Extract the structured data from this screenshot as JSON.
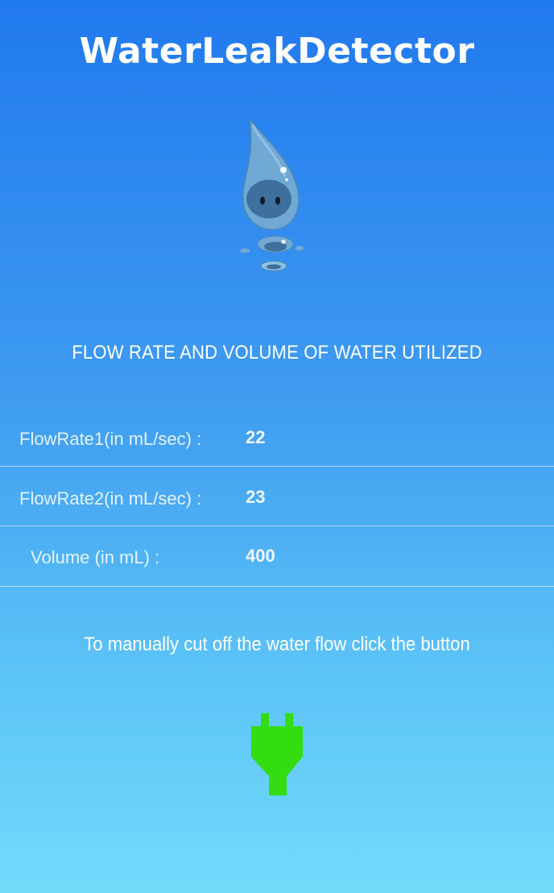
{
  "app": {
    "title": "WaterLeakDetector"
  },
  "section": {
    "heading": "FLOW RATE AND VOLUME OF WATER UTILIZED"
  },
  "readings": [
    {
      "label": "FlowRate1(in mL/sec) :",
      "value": "22"
    },
    {
      "label": "FlowRate2(in mL/sec) :",
      "value": "23"
    },
    {
      "label": "Volume (in mL) :",
      "value": "400"
    }
  ],
  "instruction": "To manually cut off the water flow click the button",
  "icons": {
    "mascot": "water-drop-mascot-icon",
    "cutoff": "plug-icon"
  },
  "colors": {
    "plug": "#33dd11",
    "bg_top": "#2179ee",
    "bg_bottom": "#72dbfb"
  }
}
